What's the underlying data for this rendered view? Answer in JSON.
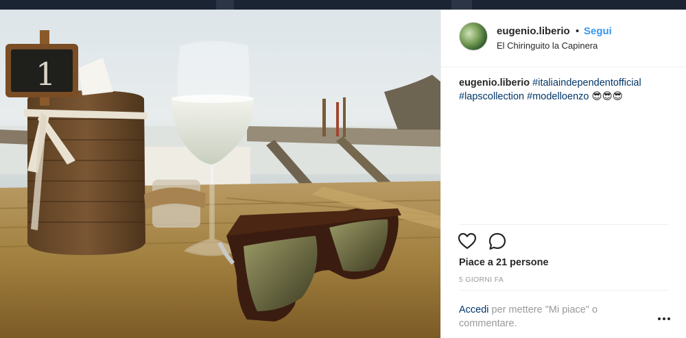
{
  "post": {
    "username": "eugenio.liberio",
    "separator": "•",
    "follow_label": "Segui",
    "location": "El Chiringuito la Capinera",
    "caption": {
      "username": "eugenio.liberio",
      "hashtags": [
        "#italiaindependentofficial",
        "#lapscollection",
        "#modelloenzo"
      ],
      "emoji": "😎😎😎"
    },
    "likes_text": "Piace a 21 persone",
    "time_ago": "5 GIORNI FA",
    "login_prompt": {
      "link": "Accedi",
      "text": " per mettere \"Mi piace\" o commentare."
    }
  },
  "icons": {
    "like": "heart-icon",
    "comment": "comment-icon",
    "more": "more-options-icon"
  },
  "colors": {
    "link_blue": "#3897f0",
    "hashtag_blue": "#003569",
    "text": "#262626",
    "muted": "#999999",
    "topbar": "#1b2432"
  }
}
